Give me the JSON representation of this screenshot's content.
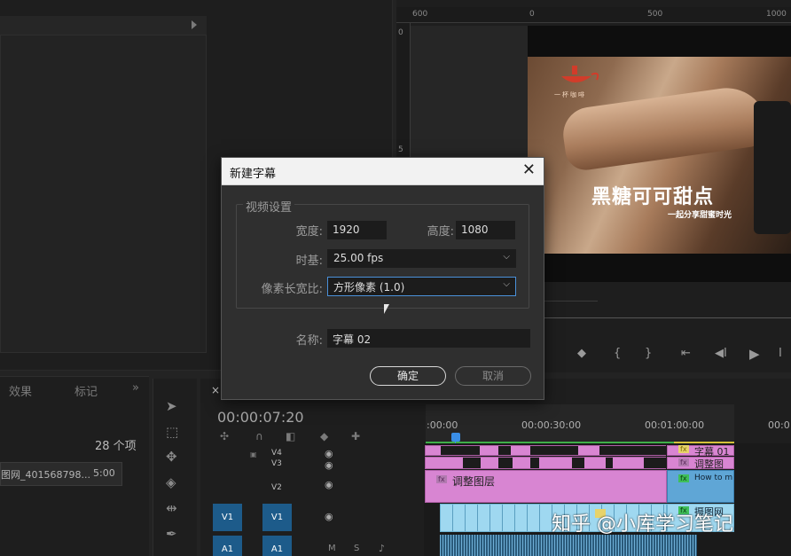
{
  "project_panel": {
    "tabs": {
      "effects": "效果",
      "markers": "标记",
      "more": "»"
    },
    "item_count": "28 个项",
    "item_name": "图网_401568798...",
    "item_duration": "5:00"
  },
  "monitor": {
    "ruler_labels": {
      "left": "600",
      "zero": "0",
      "mid": "500",
      "right": "1000"
    },
    "vertical_ruler": {
      "zero": "0",
      "five": "5"
    },
    "video_title": "黑糖可可甜点",
    "video_subtitle": "一起分享甜蜜时光",
    "logo_text": "一杯咖啡"
  },
  "dialog": {
    "title": "新建字幕",
    "close_symbol": "✕",
    "group_label": "视频设置",
    "width_label": "宽度:",
    "width_value": "1920",
    "height_label": "高度:",
    "height_value": "1080",
    "timebase_label": "时基:",
    "timebase_value": "25.00 fps",
    "par_label": "像素长宽比:",
    "par_value": "方形像素 (1.0)",
    "name_label": "名称:",
    "name_value": "字幕 02",
    "ok_label": "确定",
    "cancel_label": "取消"
  },
  "timeline": {
    "tab_close": "×",
    "timecode": "00:00:07:20",
    "ruler": {
      "t0": ":00:00",
      "t30": "00:00:30:00",
      "t60": "00:01:00:00",
      "t90": "00:0"
    },
    "tracks": {
      "v4": "V4",
      "v3": "V3",
      "v2": "V2",
      "v1": "V1",
      "a1": "A1",
      "m": "M",
      "s": "S"
    },
    "clips": {
      "subtitle01": "字幕 01",
      "adjust_short": "调整图",
      "adjust_layer": "调整图层",
      "howto": "How to m",
      "photo": "摄图网",
      "fx": "fx"
    }
  },
  "watermark": "知乎 @小库学习笔记"
}
